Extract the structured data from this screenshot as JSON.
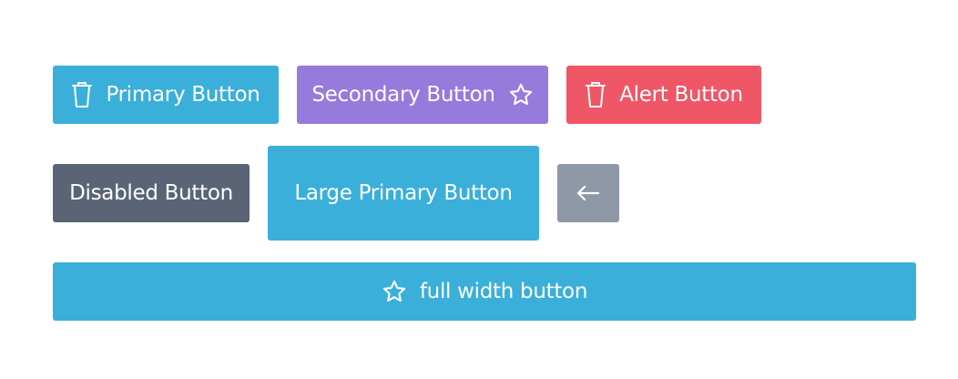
{
  "buttons": {
    "primary": {
      "label": "Primary Button",
      "icon": "trash-icon",
      "color": "#3aafda"
    },
    "secondary": {
      "label": "Secondary Button",
      "icon": "star-icon",
      "color": "#967adc"
    },
    "alert": {
      "label": "Alert Button",
      "icon": "trash-icon",
      "color": "#ef5666"
    },
    "disabled": {
      "label": "Disabled Button",
      "color": "#5a6476"
    },
    "large_primary": {
      "label": "Large Primary Button",
      "color": "#3aafda"
    },
    "back": {
      "icon": "arrow-left-icon",
      "color": "#8d97a6"
    },
    "full_width": {
      "label": "full width button",
      "icon": "star-icon",
      "color": "#3aafda"
    }
  }
}
